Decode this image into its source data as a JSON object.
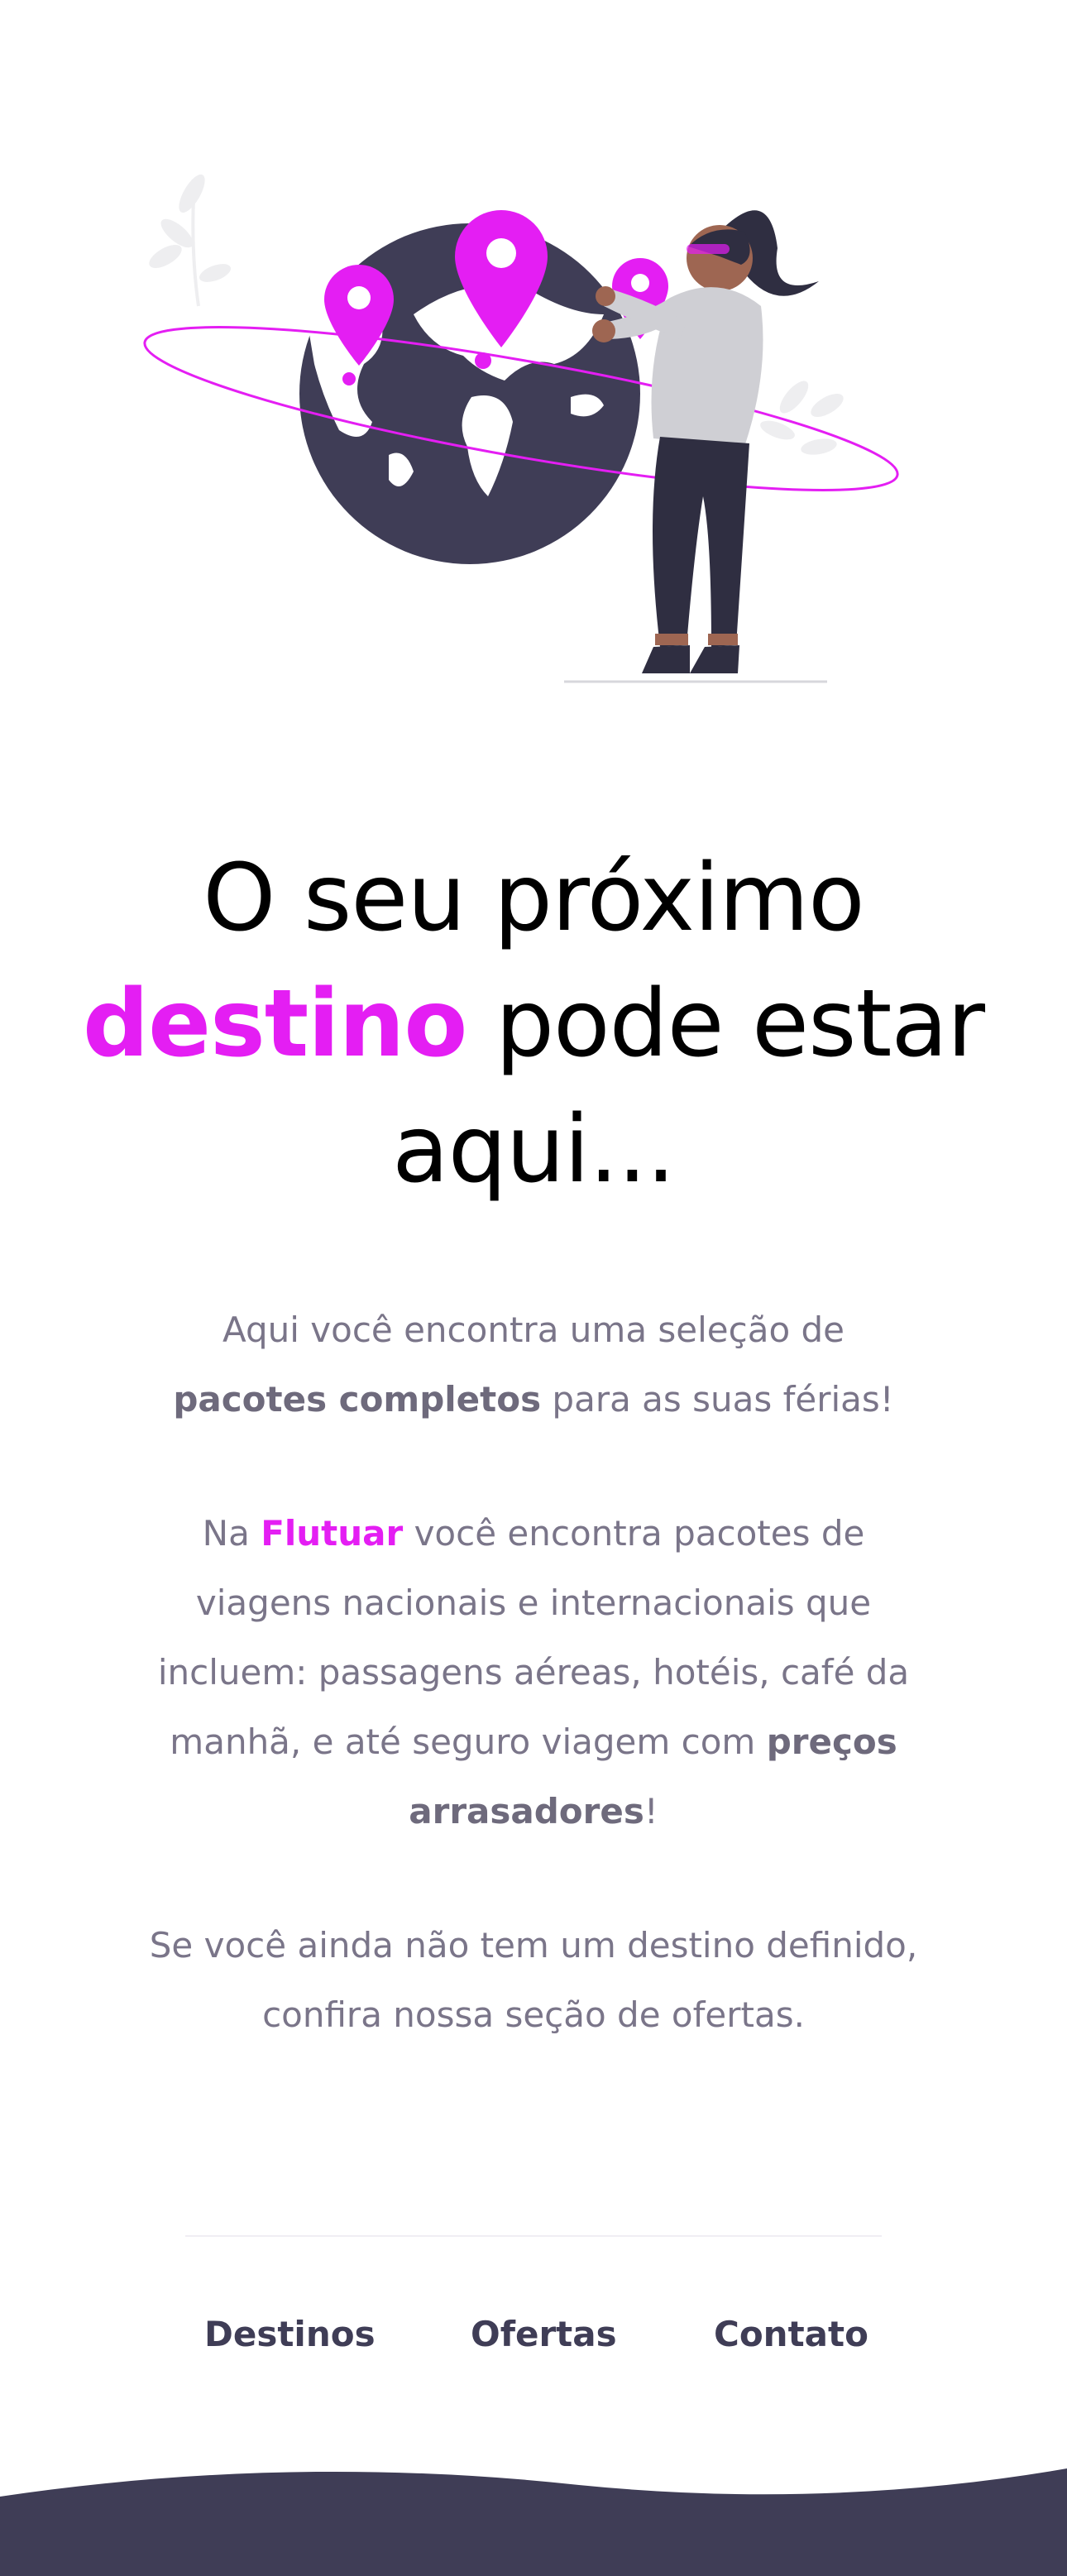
{
  "hero": {
    "illustration": "woman-pinning-locations-on-globe",
    "colors": {
      "accent": "#e41ef3",
      "dark": "#3f3d56",
      "sweater": "#cfcfd4"
    }
  },
  "headline": {
    "line1": "O seu próximo",
    "accent": "destino",
    "line2_rest": " pode estar",
    "line3": "aqui..."
  },
  "intro": {
    "p1_a": "Aqui você encontra uma seleção de ",
    "p1_bold": "pacotes completos",
    "p1_b": " para as suas férias!",
    "p2_a": "Na ",
    "p2_brand": "Flutuar",
    "p2_b": " você encontra pacotes de viagens nacionais e internacionais que incluem: passagens aéreas, hotéis, café da manhã, e até seguro viagem com ",
    "p2_bold": "preços arrasadores",
    "p2_c": "!",
    "p3": "Se você ainda não tem um destino definido, confira nossa seção de ofertas."
  },
  "footer": {
    "nav": [
      {
        "label": "Destinos"
      },
      {
        "label": "Ofertas"
      },
      {
        "label": "Contato"
      }
    ],
    "wave_color": "#3f3d56"
  }
}
